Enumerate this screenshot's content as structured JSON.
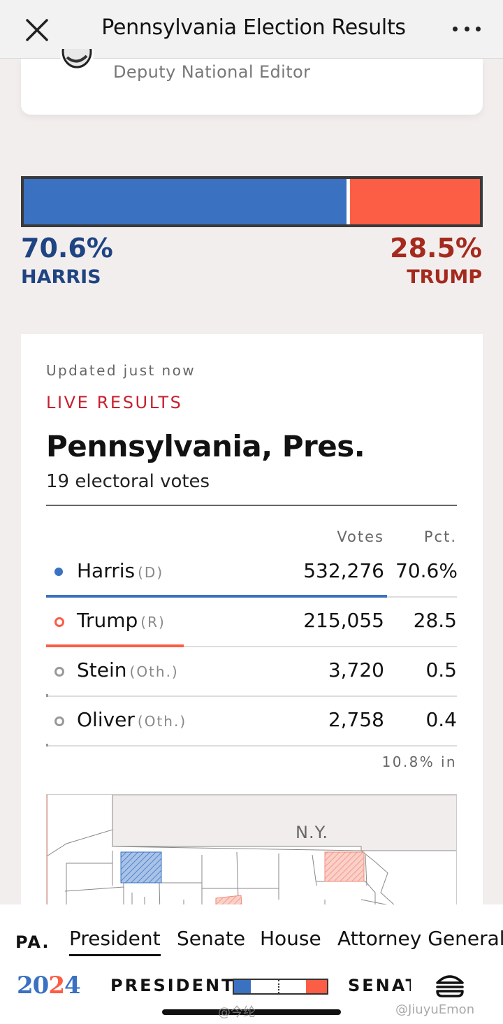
{
  "header": {
    "title": "Pennsylvania Election Results",
    "close_icon": "close-icon",
    "more_icon": "more-horizontal-icon"
  },
  "author": {
    "role": "Deputy National Editor"
  },
  "topline": {
    "harris": {
      "pct": "70.6%",
      "name": "HARRIS",
      "share": 70.6,
      "color": "#3a71c1"
    },
    "trump": {
      "pct": "28.5%",
      "name": "TRUMP",
      "share": 28.5,
      "color": "#fc5d45"
    }
  },
  "results": {
    "updated": "Updated just now",
    "live_label": "LIVE RESULTS",
    "race_title": "Pennsylvania, Pres.",
    "electoral_votes": "19 electoral votes",
    "columns": {
      "votes": "Votes",
      "pct": "Pct."
    },
    "candidates": [
      {
        "name": "Harris",
        "party": "(D)",
        "votes": "532,276",
        "pct": "70.6%",
        "share": 70.6,
        "color": "#3a71c1",
        "marker": "filled"
      },
      {
        "name": "Trump",
        "party": "(R)",
        "votes": "215,055",
        "pct": "28.5",
        "share": 28.5,
        "color": "#fc5d45",
        "marker": "ring"
      },
      {
        "name": "Stein",
        "party": "(Oth.)",
        "votes": "3,720",
        "pct": "0.5",
        "share": 0.5,
        "color": "#999999",
        "marker": "ring"
      },
      {
        "name": "Oliver",
        "party": "(Oth.)",
        "votes": "2,758",
        "pct": "0.4",
        "share": 0.4,
        "color": "#999999",
        "marker": "ring"
      }
    ],
    "reporting": "10.8% in"
  },
  "map": {
    "neighbor_label": "N.Y."
  },
  "nav": {
    "state": "PA.",
    "tabs": [
      {
        "label": "President",
        "active": true
      },
      {
        "label": "Senate",
        "active": false
      },
      {
        "label": "House",
        "active": false
      },
      {
        "label": "Attorney General",
        "active": false
      }
    ]
  },
  "ticker": {
    "year_part1": "20",
    "year_part2": "2",
    "year_part3": "4",
    "president_label": "PRESIDENT",
    "senate_label": "SENATE",
    "burger_icon": "hamburger-icon"
  },
  "watermarks": {
    "left": "@今纶",
    "right": "@JiuyuEmon"
  }
}
